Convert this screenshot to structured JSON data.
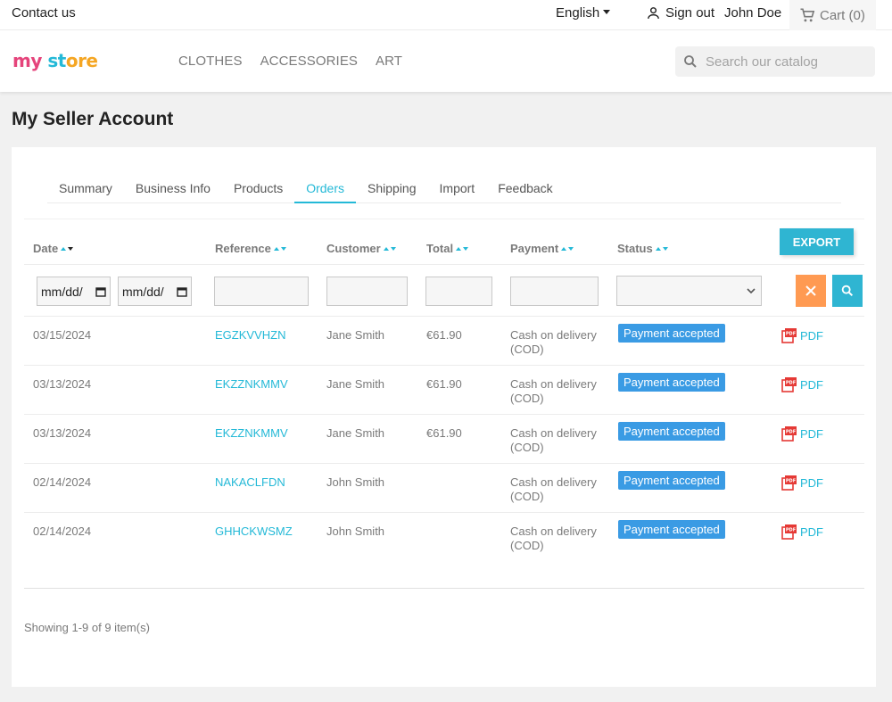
{
  "topbar": {
    "contact": "Contact us",
    "language": "English",
    "sign_out": "Sign out",
    "user_name": "John Doe",
    "cart": "Cart (0)"
  },
  "header": {
    "logo": {
      "part1": "my",
      "part2": " ",
      "part3": "st",
      "part4": "ore"
    },
    "nav": [
      "CLOTHES",
      "ACCESSORIES",
      "ART"
    ],
    "search_placeholder": "Search our catalog"
  },
  "page": {
    "title": "My Seller Account"
  },
  "tabs": [
    {
      "label": "Summary",
      "active": false
    },
    {
      "label": "Business Info",
      "active": false
    },
    {
      "label": "Products",
      "active": false
    },
    {
      "label": "Orders",
      "active": true
    },
    {
      "label": "Shipping",
      "active": false
    },
    {
      "label": "Import",
      "active": false
    },
    {
      "label": "Feedback",
      "active": false
    }
  ],
  "table": {
    "columns": {
      "date": "Date",
      "reference": "Reference",
      "customer": "Customer",
      "total": "Total",
      "payment": "Payment",
      "status": "Status"
    },
    "export_label": "EXPORT",
    "filters": {
      "date_from_placeholder": "mm/dd/yyyy",
      "date_to_placeholder": "mm/dd/yyyy",
      "date_display": "mm/dd/"
    },
    "rows": [
      {
        "date": "03/15/2024",
        "reference": "EGZKVVHZN",
        "customer": "Jane Smith",
        "total": "€61.90",
        "payment_line1": "Cash on delivery",
        "payment_line2": "(COD)",
        "status": "Payment accepted",
        "pdf": "PDF"
      },
      {
        "date": "03/13/2024",
        "reference": "EKZZNKMMV",
        "customer": "Jane Smith",
        "total": "€61.90",
        "payment_line1": "Cash on delivery",
        "payment_line2": "(COD)",
        "status": "Payment accepted",
        "pdf": "PDF"
      },
      {
        "date": "03/13/2024",
        "reference": "EKZZNKMMV",
        "customer": "Jane Smith",
        "total": "€61.90",
        "payment_line1": "Cash on delivery",
        "payment_line2": "(COD)",
        "status": "Payment accepted",
        "pdf": "PDF"
      },
      {
        "date": "02/14/2024",
        "reference": "NAKACLFDN",
        "customer": "John Smith",
        "total": "",
        "payment_line1": "Cash on delivery",
        "payment_line2": "(COD)",
        "status": "Payment accepted",
        "pdf": "PDF"
      },
      {
        "date": "02/14/2024",
        "reference": "GHHCKWSMZ",
        "customer": "John Smith",
        "total": "",
        "payment_line1": "Cash on delivery",
        "payment_line2": "(COD)",
        "status": "Payment accepted",
        "pdf": "PDF"
      }
    ],
    "showing": "Showing 1-9 of 9 item(s)"
  },
  "colors": {
    "accent": "#24b9d7",
    "badge": "#3a9be4",
    "clear_button": "#ff9a52",
    "export_button": "#2fb5d2"
  },
  "icons": {
    "user": "person-icon",
    "cart": "cart-icon",
    "search": "search-icon",
    "clear": "close-icon",
    "pdf": "pdf-icon",
    "calendar": "calendar-icon"
  }
}
